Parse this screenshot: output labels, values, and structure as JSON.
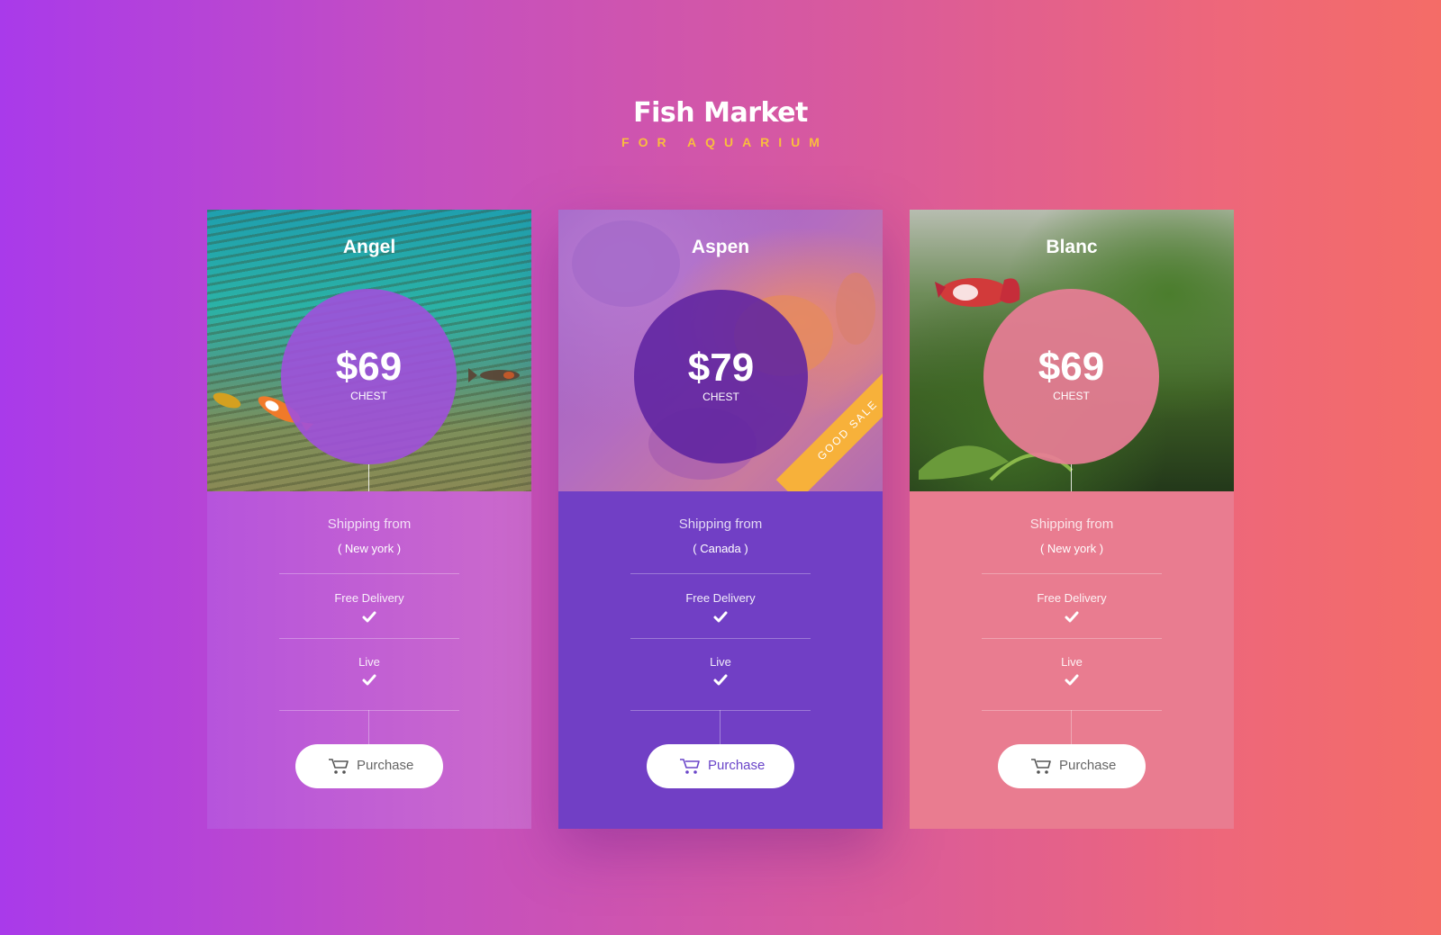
{
  "header": {
    "title": "Fish Market",
    "subtitle": "FOR AQUARIUM"
  },
  "colors": {
    "accent_yellow": "#f9bd3e",
    "ribbon": "#f7b13a",
    "card_1": "#c060d8",
    "card_2": "#713fc5",
    "card_3": "#e97c90"
  },
  "cards": [
    {
      "name": "Angel",
      "price": "$69",
      "unit": "CHEST",
      "shipping_label": "Shipping from",
      "origin": "( New york )",
      "features": [
        {
          "label": "Free Delivery",
          "icon": "check-icon"
        },
        {
          "label": "Live",
          "icon": "check-icon"
        }
      ],
      "button_label": "Purchase",
      "button_icon": "cart-icon"
    },
    {
      "name": "Aspen",
      "price": "$79",
      "unit": "CHEST",
      "ribbon": "GOOD SALE",
      "shipping_label": "Shipping from",
      "origin": "( Canada )",
      "features": [
        {
          "label": "Free Delivery",
          "icon": "check-icon"
        },
        {
          "label": "Live",
          "icon": "check-icon"
        }
      ],
      "button_label": "Purchase",
      "button_icon": "cart-icon"
    },
    {
      "name": "Blanc",
      "price": "$69",
      "unit": "CHEST",
      "shipping_label": "Shipping from",
      "origin": "( New york )",
      "features": [
        {
          "label": "Free Delivery",
          "icon": "check-icon"
        },
        {
          "label": "Live",
          "icon": "check-icon"
        }
      ],
      "button_label": "Purchase",
      "button_icon": "cart-icon"
    }
  ]
}
